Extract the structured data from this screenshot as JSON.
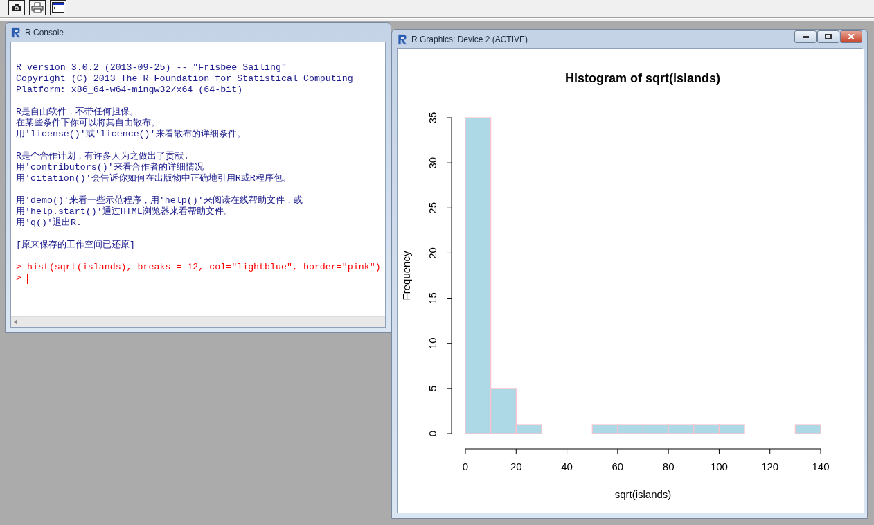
{
  "toolbar": [
    {
      "kind": "camera"
    },
    {
      "kind": "printer"
    },
    {
      "kind": "console"
    }
  ],
  "console_window": {
    "title": "R Console",
    "blocks": [
      [
        {
          "kind": "output",
          "text": "R version 3.0.2 (2013-09-25) -- \"Frisbee Sailing\""
        },
        {
          "kind": "output",
          "text": "Copyright (C) 2013 The R Foundation for Statistical Computing"
        },
        {
          "kind": "output",
          "text": "Platform: x86_64-w64-mingw32/x64 (64-bit)"
        }
      ],
      [
        {
          "kind": "output",
          "text": "R是自由软件，不带任何担保。"
        },
        {
          "kind": "output",
          "text": "在某些条件下你可以将其自由散布。"
        },
        {
          "kind": "output",
          "text": "用'license()'或'licence()'来看散布的详细条件。"
        }
      ],
      [
        {
          "kind": "output",
          "text": "R是个合作计划，有许多人为之做出了贡献."
        },
        {
          "kind": "output",
          "text": "用'contributors()'来看合作者的详细情况"
        },
        {
          "kind": "output",
          "text": "用'citation()'会告诉你如何在出版物中正确地引用R或R程序包。"
        }
      ],
      [
        {
          "kind": "output",
          "text": "用'demo()'来看一些示范程序，用'help()'来阅读在线帮助文件，或"
        },
        {
          "kind": "output",
          "text": "用'help.start()'通过HTML浏览器来看帮助文件。"
        },
        {
          "kind": "output",
          "text": "用'q()'退出R."
        }
      ],
      [
        {
          "kind": "output",
          "text": "[原来保存的工作空间已还原]"
        }
      ],
      [
        {
          "kind": "command",
          "prompt": ">",
          "text": "hist(sqrt(islands), breaks = 12, col=\"lightblue\", border=\"pink\")"
        },
        {
          "kind": "prompt",
          "prompt": ">",
          "cursor": true
        }
      ]
    ]
  },
  "graphics_window": {
    "title": "R Graphics: Device 2 (ACTIVE)",
    "controls": [
      {
        "kind": "minimize"
      },
      {
        "kind": "restore"
      },
      {
        "kind": "close"
      }
    ],
    "chart_data": {
      "type": "bar",
      "title": "Histogram of sqrt(islands)",
      "xlabel": "sqrt(islands)",
      "ylabel": "Frequency",
      "x": [
        5,
        15,
        25,
        35,
        45,
        55,
        65,
        75,
        85,
        95,
        105,
        115,
        125,
        135
      ],
      "series": [
        {
          "color": "#add8e6",
          "values": [
            35,
            5,
            1,
            0,
            0,
            1,
            1,
            1,
            1,
            1,
            1,
            0,
            0,
            1
          ]
        }
      ],
      "xlim": [
        0,
        140
      ],
      "ylim": [
        0,
        35
      ],
      "xticks": [
        0,
        20,
        40,
        60,
        80,
        100,
        120,
        140
      ],
      "yticks": [
        0,
        5,
        10,
        15,
        20,
        25,
        30,
        35
      ]
    }
  }
}
